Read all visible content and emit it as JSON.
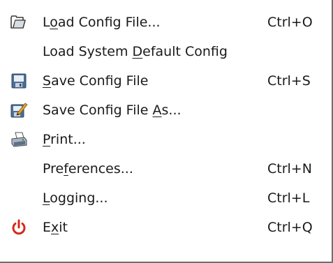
{
  "menu": {
    "items": [
      {
        "pre": "L",
        "mn": "o",
        "post": "ad Config File...",
        "shortcut": "Ctrl+O",
        "icon": "open-folder-icon"
      },
      {
        "pre": "Load System ",
        "mn": "D",
        "post": "efault Config",
        "shortcut": "",
        "icon": ""
      },
      {
        "pre": "",
        "mn": "S",
        "post": "ave Config File",
        "shortcut": "Ctrl+S",
        "icon": "floppy-disk-icon"
      },
      {
        "pre": "Save Config File ",
        "mn": "A",
        "post": "s...",
        "shortcut": "",
        "icon": "save-as-icon"
      },
      {
        "pre": "",
        "mn": "P",
        "post": "rint...",
        "shortcut": "",
        "icon": "printer-icon"
      },
      {
        "pre": "Pre",
        "mn": "f",
        "post": "erences...",
        "shortcut": "Ctrl+N",
        "icon": ""
      },
      {
        "pre": "",
        "mn": "L",
        "post": "ogging...",
        "shortcut": "Ctrl+L",
        "icon": ""
      },
      {
        "pre": "E",
        "mn": "x",
        "post": "it",
        "shortcut": "Ctrl+Q",
        "icon": "power-icon"
      }
    ],
    "colors": {
      "text": "#1a1a1a",
      "exit_icon": "#d42a1b",
      "floppy": "#4a6f96"
    }
  }
}
